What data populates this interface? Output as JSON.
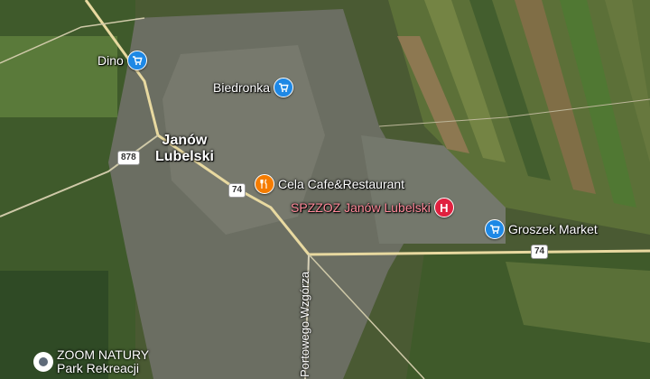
{
  "map": {
    "town_name_line1": "Janów",
    "town_name_line2": "Lubelski",
    "road_shields": [
      "878",
      "74",
      "74"
    ],
    "street_name": "Portowego Wzgórza",
    "pois": [
      {
        "name": "Dino",
        "icon": "shopping-cart-icon",
        "color": "#1e88e5"
      },
      {
        "name": "Biedronka",
        "icon": "shopping-cart-icon",
        "color": "#1e88e5"
      },
      {
        "name": "Cela Cafe&Restaurant",
        "icon": "fork-knife-icon",
        "color": "#f57c00"
      },
      {
        "name": "SPZZOZ Janów Lubelski",
        "icon": "hospital-icon",
        "color": "#e0203f"
      },
      {
        "name": "Groszek Market",
        "icon": "shopping-cart-icon",
        "color": "#1e88e5"
      },
      {
        "name_line1": "ZOOM NATURY",
        "name_line2": "Park Rekreacji",
        "icon": "place-pin-icon",
        "color": "#5f6b7a"
      }
    ]
  }
}
